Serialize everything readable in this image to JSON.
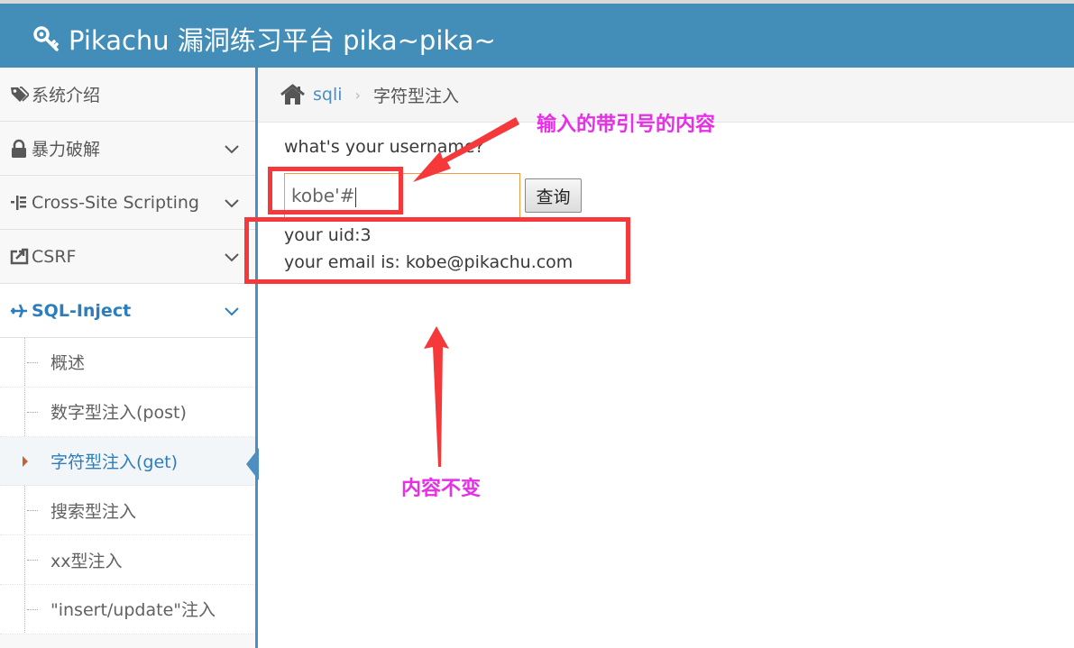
{
  "header": {
    "title": "Pikachu 漏洞练习平台 pika~pika~"
  },
  "sidebar": {
    "items": [
      {
        "label": "系统介绍",
        "icon": "tags-icon"
      },
      {
        "label": "暴力破解",
        "icon": "lock-icon"
      },
      {
        "label": "Cross-Site Scripting",
        "icon": "list-tree-icon"
      },
      {
        "label": "CSRF",
        "icon": "share-icon"
      },
      {
        "label": "SQL-Inject",
        "icon": "plane-icon"
      }
    ],
    "sub_items": [
      {
        "label": "概述"
      },
      {
        "label": "数字型注入(post)"
      },
      {
        "label": "字符型注入(get)"
      },
      {
        "label": "搜索型注入"
      },
      {
        "label": "xx型注入"
      },
      {
        "label": "\"insert/update\"注入"
      }
    ]
  },
  "breadcrumb": {
    "link": "sqli",
    "current": "字符型注入"
  },
  "form": {
    "question": "what's your username?",
    "input_value": "kobe'#",
    "button_label": "查询"
  },
  "result": {
    "uid_line": "your uid:3",
    "email_line": "your email is: kobe@pikachu.com"
  },
  "annotations": {
    "input_note": "输入的带引号的内容",
    "result_note": "内容不变",
    "color_box": "#f5393b",
    "color_text": "#e62fe6"
  },
  "colors": {
    "header_bg": "#438eb9",
    "accent": "#2b7dbc",
    "input_border": "#f59942"
  }
}
